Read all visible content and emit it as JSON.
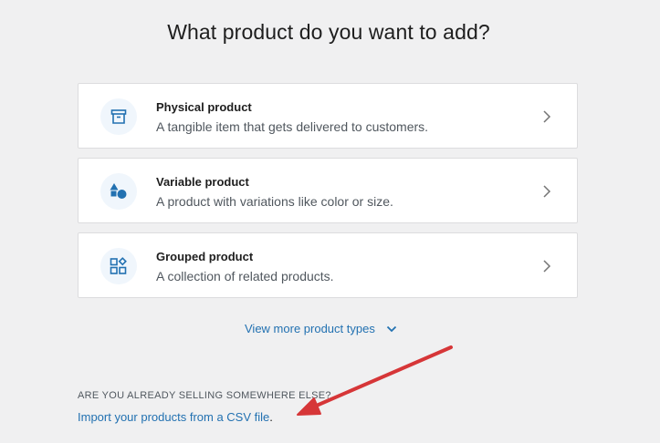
{
  "page": {
    "title": "What product do you want to add?"
  },
  "product_types": [
    {
      "title": "Physical product",
      "description": "A tangible item that gets delivered to customers.",
      "icon": "archive-box-icon"
    },
    {
      "title": "Variable product",
      "description": "A product with variations like color or size.",
      "icon": "shapes-icon"
    },
    {
      "title": "Grouped product",
      "description": "A collection of related products.",
      "icon": "blocks-grid-icon"
    }
  ],
  "more_types": {
    "label": "View more product types"
  },
  "import_section": {
    "heading": "ARE YOU ALREADY SELLING SOMEWHERE ELSE?",
    "link_text": "Import your products from a CSV file",
    "suffix": "."
  },
  "colors": {
    "accent": "#2271b1",
    "icon_bg": "#f0f6fc",
    "background": "#f0f0f1",
    "annotation_arrow": "#d63638"
  }
}
